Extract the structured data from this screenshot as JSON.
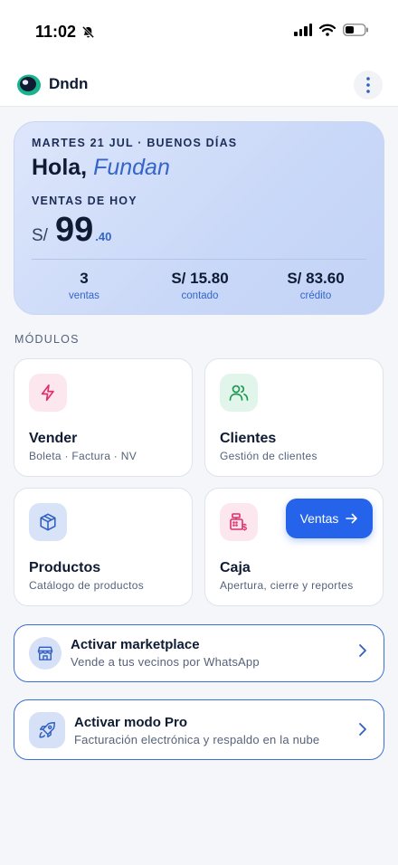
{
  "status": {
    "time": "11:02"
  },
  "app": {
    "name": "Dndn"
  },
  "hero": {
    "date_line": "MARTES 21 JUL · BUENOS DÍAS",
    "greeting": "Hola,",
    "user_name": "Fundan",
    "sales_label": "VENTAS DE HOY",
    "currency": "S/",
    "amount_int": "99",
    "amount_dec": ".40",
    "stats": [
      {
        "value": "3",
        "label": "ventas"
      },
      {
        "value": "S/ 15.80",
        "label": "contado"
      },
      {
        "value": "S/ 83.60",
        "label": "crédito"
      }
    ]
  },
  "modules": {
    "title": "MÓDULOS",
    "items": [
      {
        "title": "Vender",
        "subtitle": "Boleta · Factura · NV",
        "icon": "lightning-icon",
        "icon_bg": "#fde7ef",
        "icon_color": "#e0306b"
      },
      {
        "title": "Clientes",
        "subtitle": "Gestión de clientes",
        "icon": "users-icon",
        "icon_bg": "#e2f5ea",
        "icon_color": "#1f9a55"
      },
      {
        "title": "Productos",
        "subtitle": "Catálogo de productos",
        "icon": "box-icon",
        "icon_bg": "#d9e3f8",
        "icon_color": "#2f5fc4"
      },
      {
        "title": "Caja",
        "subtitle": "Apertura, cierre y reportes",
        "icon": "cash-register-icon",
        "icon_bg": "#fde7ef",
        "icon_color": "#e0306b"
      }
    ],
    "ventas_button": "Ventas"
  },
  "banners": [
    {
      "title": "Activar marketplace",
      "subtitle": "Vende a tus vecinos por WhatsApp",
      "icon": "store-icon"
    },
    {
      "title": "Activar modo Pro",
      "subtitle": "Facturación electrónica y respaldo en la nube",
      "icon": "rocket-icon"
    }
  ],
  "colors": {
    "accent": "#2563eb",
    "hero_bg": "#cdd9f7",
    "text": "#0f1b33"
  }
}
